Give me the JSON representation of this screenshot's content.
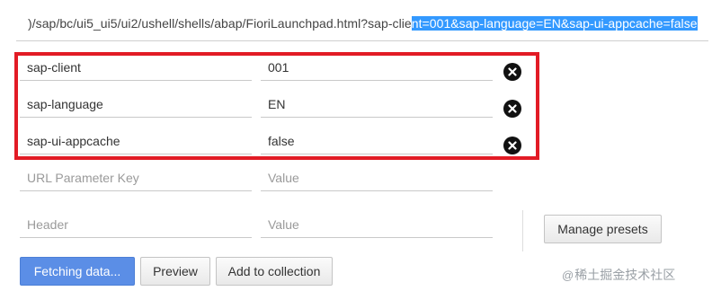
{
  "url_bar": {
    "prefix": ")/sap/bc/ui5_ui5/ui2/ushell/shells/abap/FioriLaunchpad.html?sap-clie",
    "selected": "nt=001&sap-language=EN&sap-ui-appcache=false"
  },
  "params": [
    {
      "key": "sap-client",
      "value": "001"
    },
    {
      "key": "sap-language",
      "value": "EN"
    },
    {
      "key": "sap-ui-appcache",
      "value": "false"
    }
  ],
  "new_param": {
    "key_placeholder": "URL Parameter Key",
    "value_placeholder": "Value"
  },
  "header_row": {
    "key_placeholder": "Header",
    "value_placeholder": "Value"
  },
  "buttons": {
    "manage_presets": "Manage presets",
    "fetching": "Fetching data...",
    "preview": "Preview",
    "add_to_collection": "Add to collection"
  },
  "watermark": {
    "at": "@",
    "text": "稀土掘金技术社区"
  },
  "colors": {
    "highlight_border": "#e21b25",
    "primary_button": "#5b8ee6",
    "selection": "#3399ff"
  }
}
